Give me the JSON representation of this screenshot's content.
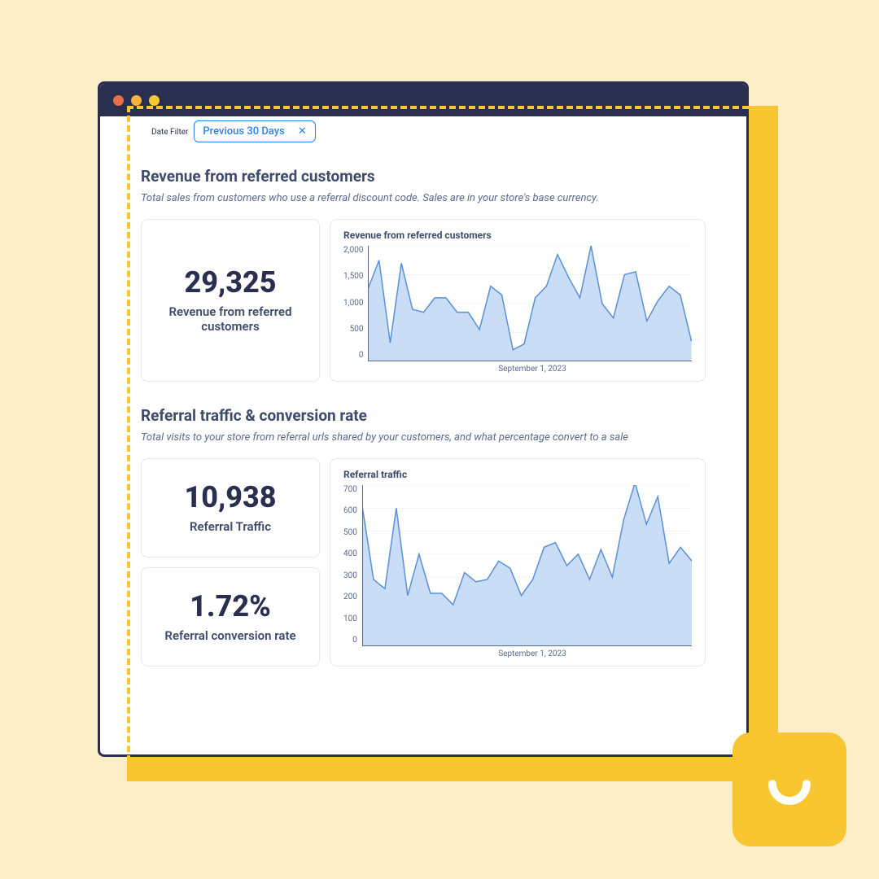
{
  "filter": {
    "label": "Date Filter",
    "value": "Previous 30 Days"
  },
  "section1": {
    "title": "Revenue from referred customers",
    "subtitle": "Total sales from customers who use a referral discount code. Sales are in your store's base currency.",
    "stat_value": "29,325",
    "stat_label": "Revenue from referred customers",
    "chart_title": "Revenue from referred customers",
    "chart_xlabel": "September 1, 2023"
  },
  "section2": {
    "title": "Referral traffic & conversion rate",
    "subtitle": "Total visits to your store from referral urls shared by your customers, and what percentage convert to a sale",
    "stat1_value": "10,938",
    "stat1_label": "Referral Traffic",
    "stat2_value": "1.72%",
    "stat2_label": "Referral conversion rate",
    "chart_title": "Referral traffic",
    "chart_xlabel": "September 1, 2023"
  },
  "chart_data": [
    {
      "type": "area",
      "title": "Revenue from referred customers",
      "xlabel": "September 1, 2023",
      "ylabel": "",
      "ylim": [
        0,
        2000
      ],
      "y_ticks": [
        2000,
        1500,
        1000,
        500,
        0
      ],
      "x": [
        1,
        2,
        3,
        4,
        5,
        6,
        7,
        8,
        9,
        10,
        11,
        12,
        13,
        14,
        15,
        16,
        17,
        18,
        19,
        20,
        21,
        22,
        23,
        24,
        25,
        26,
        27,
        28,
        29,
        30
      ],
      "values": [
        1250,
        1750,
        320,
        1700,
        900,
        850,
        1100,
        1100,
        850,
        850,
        550,
        1300,
        1150,
        200,
        300,
        1100,
        1300,
        1850,
        1450,
        1100,
        2000,
        1000,
        750,
        1500,
        1550,
        700,
        1050,
        1300,
        1150,
        350
      ]
    },
    {
      "type": "area",
      "title": "Referral traffic",
      "xlabel": "September 1, 2023",
      "ylabel": "",
      "ylim": [
        0,
        700
      ],
      "y_ticks": [
        700,
        600,
        500,
        400,
        300,
        200,
        100,
        0
      ],
      "x": [
        1,
        2,
        3,
        4,
        5,
        6,
        7,
        8,
        9,
        10,
        11,
        12,
        13,
        14,
        15,
        16,
        17,
        18,
        19,
        20,
        21,
        22,
        23,
        24,
        25,
        26,
        27,
        28,
        29,
        30
      ],
      "values": [
        610,
        290,
        250,
        600,
        220,
        400,
        230,
        230,
        180,
        320,
        280,
        290,
        370,
        340,
        220,
        290,
        430,
        450,
        350,
        400,
        290,
        420,
        300,
        550,
        710,
        530,
        650,
        360,
        430,
        370
      ]
    }
  ]
}
